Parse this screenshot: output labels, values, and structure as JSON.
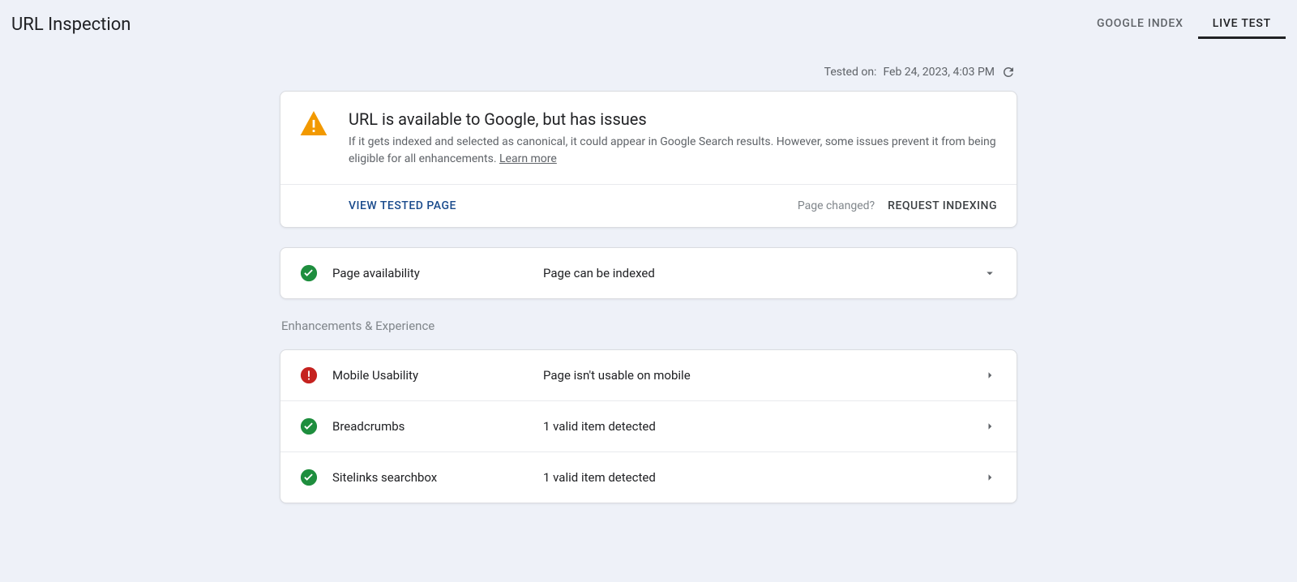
{
  "header": {
    "title": "URL Inspection",
    "tabs": {
      "google_index": "GOOGLE INDEX",
      "live_test": "LIVE TEST"
    }
  },
  "tested": {
    "label": "Tested on:",
    "value": "Feb 24, 2023, 4:03 PM"
  },
  "status": {
    "title": "URL is available to Google, but has issues",
    "desc_part1": "If it gets indexed and selected as canonical, it could appear in Google Search results. However, some issues prevent it from being eligible for all enhancements. ",
    "learn_more": "Learn more",
    "view_tested": "VIEW TESTED PAGE",
    "page_changed": "Page changed?",
    "request_indexing": "REQUEST INDEXING"
  },
  "availability": {
    "label": "Page availability",
    "value": "Page can be indexed"
  },
  "enhancements_heading": "Enhancements & Experience",
  "rows": {
    "mobile": {
      "label": "Mobile Usability",
      "value": "Page isn't usable on mobile"
    },
    "breadcrumbs": {
      "label": "Breadcrumbs",
      "value": "1 valid item detected"
    },
    "sitelinks": {
      "label": "Sitelinks searchbox",
      "value": "1 valid item detected"
    }
  }
}
